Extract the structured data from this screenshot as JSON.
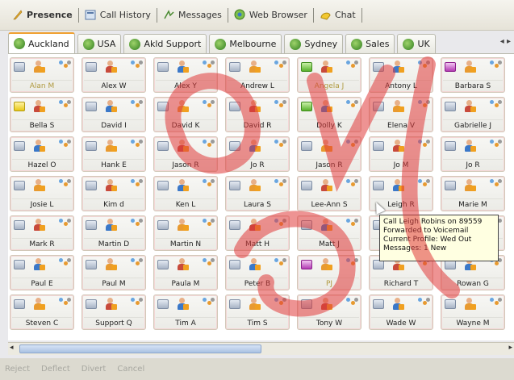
{
  "toolbar": {
    "items": [
      {
        "label": "Presence",
        "icon": "presence-icon",
        "active": true
      },
      {
        "label": "Call History",
        "icon": "call-history-icon"
      },
      {
        "label": "Messages",
        "icon": "messages-icon"
      },
      {
        "label": "Web Browser",
        "icon": "web-browser-icon"
      },
      {
        "label": "Chat",
        "icon": "chat-icon"
      }
    ]
  },
  "tabs": [
    {
      "label": "Auckland",
      "active": true
    },
    {
      "label": "USA"
    },
    {
      "label": "Akld Support"
    },
    {
      "label": "Melbourne"
    },
    {
      "label": "Sydney"
    },
    {
      "label": "Sales"
    },
    {
      "label": "UK"
    }
  ],
  "tab_scroll_label": "◂ ▸",
  "contacts": [
    [
      "Alan M",
      "Alex W",
      "Alex Y",
      "Andrew L",
      "Angela J",
      "Antony L",
      "Barbara S"
    ],
    [
      "Bella S",
      "David I",
      "David K",
      "David R",
      "Dolly K",
      "Elena V",
      "Gabrielle J"
    ],
    [
      "Hazel O",
      "Hank E",
      "Jason R",
      "Jo R",
      "Jason R",
      "Jo M",
      "Jo R"
    ],
    [
      "Josie L",
      "Kim d",
      "Ken L",
      "Laura S",
      "Lee-Ann S",
      "Leigh R",
      "Marie M"
    ],
    [
      "Mark R",
      "Martin D",
      "Martin N",
      "Matt H",
      "Matt J",
      "",
      ""
    ],
    [
      "Paul E",
      "Paul M",
      "Paula M",
      "Peter B",
      "PJ",
      "Richard T",
      "Rowan G"
    ],
    [
      "Steven C",
      "Support Q",
      "Tim A",
      "Tim S",
      "Tony W",
      "Wade W",
      "Wayne M"
    ]
  ],
  "tooltip": {
    "line1": "Call Leigh Robins on 89559",
    "line2": "Forwarded to Voicemail",
    "line3": "Current Profile: Wed Out",
    "line4": "Messages: 1 New"
  },
  "scrollbar": {
    "left_arrow": "◂",
    "right_arrow": "▸"
  },
  "bottom_toolbar": {
    "items": [
      "Reject",
      "Deflect",
      "Divert",
      "Cancel"
    ]
  },
  "colors": {
    "accent_tab": "#f0a030",
    "tooltip_bg": "#ffffe1",
    "watermark": "#e03a3a"
  }
}
